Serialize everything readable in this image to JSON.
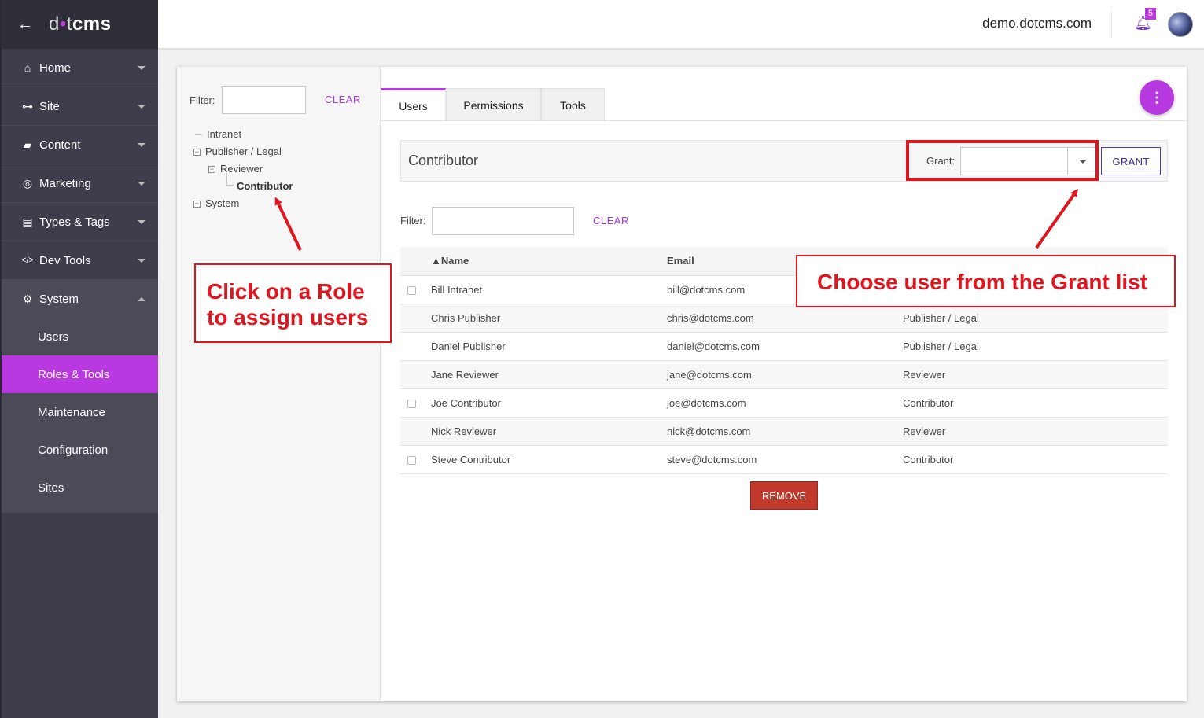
{
  "sidebar": {
    "logo": {
      "part1": "d",
      "dot": "•",
      "part2": "t",
      "part3": "cms"
    },
    "items": [
      {
        "label": "Home",
        "icon": "home-icon",
        "glyph": "⌂"
      },
      {
        "label": "Site",
        "icon": "sitemap-icon",
        "glyph": "⊶"
      },
      {
        "label": "Content",
        "icon": "folder-open-icon",
        "glyph": "▰"
      },
      {
        "label": "Marketing",
        "icon": "bullseye-icon",
        "glyph": "◎"
      },
      {
        "label": "Types & Tags",
        "icon": "file-icon",
        "glyph": "▤"
      },
      {
        "label": "Dev Tools",
        "icon": "code-icon",
        "glyph": "</>"
      },
      {
        "label": "System",
        "icon": "gear-icon",
        "glyph": "⚙"
      }
    ],
    "system_sub": [
      "Users",
      "Roles & Tools",
      "Maintenance",
      "Configuration",
      "Sites"
    ],
    "active_sub": "Roles & Tools"
  },
  "header": {
    "site": "demo.dotcms.com",
    "notifications": "5"
  },
  "tree": {
    "filter_label": "Filter:",
    "filter_value": "",
    "clear": "CLEAR",
    "nodes": {
      "intranet": "Intranet",
      "publisher": "Publisher / Legal",
      "reviewer": "Reviewer",
      "contributor": "Contributor",
      "system": "System"
    },
    "expanded_glyph": "−",
    "collapsed_glyph": "+"
  },
  "tabs": [
    "Users",
    "Permissions",
    "Tools"
  ],
  "role": {
    "name": "Contributor",
    "grant_label": "Grant:",
    "grant_value": "",
    "grant_button": "GRANT"
  },
  "users_filter": {
    "label": "Filter:",
    "value": "",
    "clear": "CLEAR"
  },
  "table": {
    "headers": [
      "▲Name",
      "Email",
      ""
    ],
    "rows": [
      {
        "name": "Bill Intranet",
        "email": "bill@dotcms.com",
        "role": "",
        "checkbox": true
      },
      {
        "name": "Chris Publisher",
        "email": "chris@dotcms.com",
        "role": "Publisher / Legal",
        "checkbox": false
      },
      {
        "name": "Daniel Publisher",
        "email": "daniel@dotcms.com",
        "role": "Publisher / Legal",
        "checkbox": false
      },
      {
        "name": "Jane Reviewer",
        "email": "jane@dotcms.com",
        "role": "Reviewer",
        "checkbox": false
      },
      {
        "name": "Joe Contributor",
        "email": "joe@dotcms.com",
        "role": "Contributor",
        "checkbox": true
      },
      {
        "name": "Nick Reviewer",
        "email": "nick@dotcms.com",
        "role": "Reviewer",
        "checkbox": false
      },
      {
        "name": "Steve Contributor",
        "email": "steve@dotcms.com",
        "role": "Contributor",
        "checkbox": true
      }
    ],
    "remove_button": "REMOVE"
  },
  "annotations": {
    "role_line1": "Click on a Role",
    "role_line2": "to assign users",
    "grant": "Choose user from the Grant list"
  },
  "colors": {
    "accent": "#b739df",
    "annotation": "#e0161e",
    "remove": "#c0392b",
    "sidebar": "#3d3d4b"
  }
}
